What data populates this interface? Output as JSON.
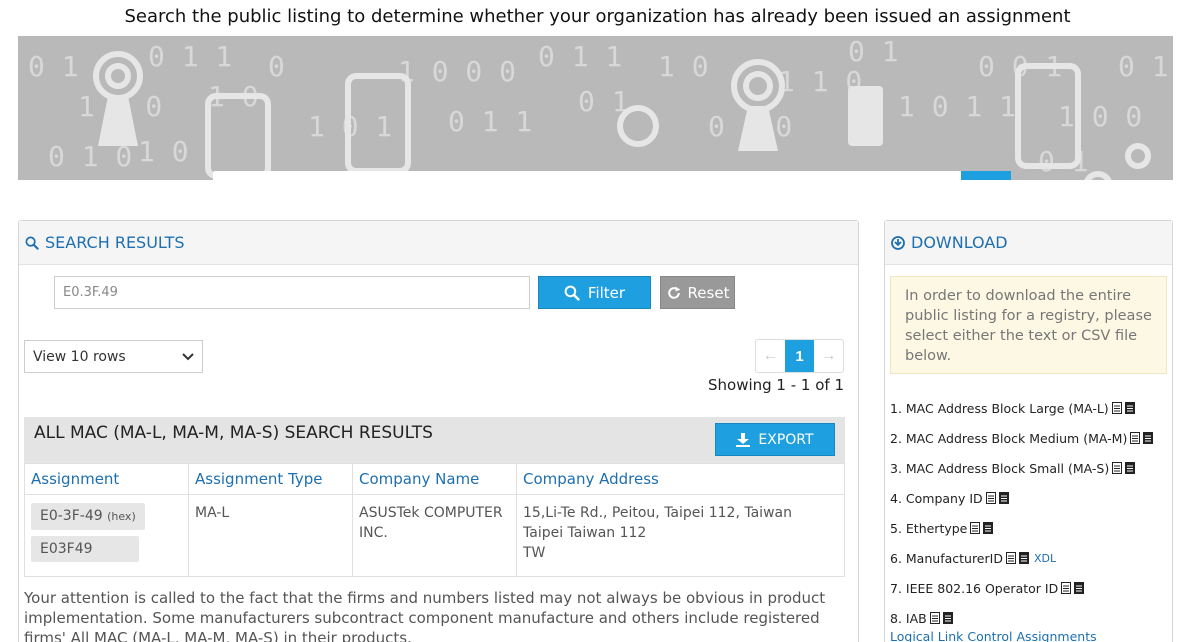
{
  "headline": "Search the public listing to determine whether your organization has already been issued an assignment",
  "search": {
    "value": "All MAC (MA-L, MA-M, MA-S)"
  },
  "results": {
    "heading": "SEARCH RESULTS",
    "filter_value": "E0.3F.49",
    "filter_label": "Filter",
    "reset_label": "Reset",
    "rows_select": "View 10 rows",
    "page_current": "1",
    "showing": "Showing 1 - 1 of 1",
    "table_title": "ALL MAC (MA-L, MA-M, MA-S) SEARCH RESULTS",
    "export_label": "EXPORT",
    "columns": [
      "Assignment",
      "Assignment Type",
      "Company Name",
      "Company Address"
    ],
    "row": {
      "assignment_hex": "E0-3F-49",
      "hex_tag": "(hex)",
      "assignment_base16": "E03F49",
      "type": "MA-L",
      "company_line1": "ASUSTek COMPUTER",
      "company_line2": "INC.",
      "address_line1": "15,Li-Te Rd., Peitou, Taipei 112, Taiwan",
      "address_line2": "Taipei Taiwan 112",
      "address_line3": "TW"
    },
    "disclaimer": "Your attention is called to the fact that the firms and numbers listed may not always be obvious in product implementation. Some manufacturers subcontract component manufacture and others include registered firms' All MAC (MA-L, MA-M, MA-S) in their products."
  },
  "download": {
    "heading": "DOWNLOAD",
    "note": "In order to download the entire public listing for a registry, please select either the text or CSV file below.",
    "items": [
      "1. MAC Address Block Large (MA-L)",
      "2. MAC Address Block Medium (MA-M)",
      "3. MAC Address Block Small (MA-S)",
      "4. Company ID",
      "5. Ethertype",
      "6. ManufacturerID",
      "7. IEEE 802.16 Operator ID",
      "8. IAB"
    ],
    "xdl_label": "XDL",
    "cut_item": "Logical Link Control Assignments"
  },
  "colors": {
    "accent": "#1e9fe0",
    "link": "#1e6fb0",
    "banner": "#b9b9b9",
    "note_bg": "#fcf8e3"
  }
}
